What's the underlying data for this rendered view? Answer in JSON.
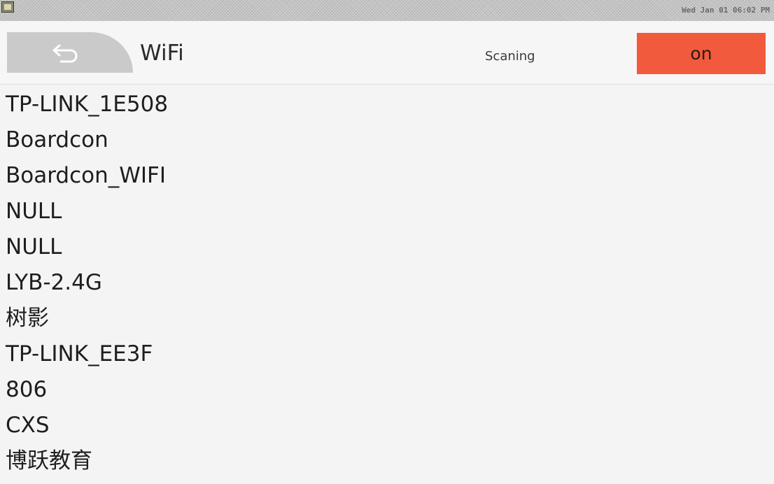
{
  "taskbar": {
    "clock": "Wed Jan 01 06:02 PM"
  },
  "header": {
    "title": "WiFi",
    "status": "Scaning",
    "toggle_label": "on"
  },
  "colors": {
    "toggle_on": "#f25a3e",
    "back_button": "#cacaca"
  },
  "networks": [
    {
      "ssid": "TP-LINK_1E508"
    },
    {
      "ssid": "Boardcon"
    },
    {
      "ssid": "Boardcon_WIFI"
    },
    {
      "ssid": "NULL"
    },
    {
      "ssid": "NULL"
    },
    {
      "ssid": "LYB-2.4G"
    },
    {
      "ssid": "树影"
    },
    {
      "ssid": "TP-LINK_EE3F"
    },
    {
      "ssid": "806"
    },
    {
      "ssid": "CXS"
    },
    {
      "ssid": "博跃教育"
    }
  ]
}
